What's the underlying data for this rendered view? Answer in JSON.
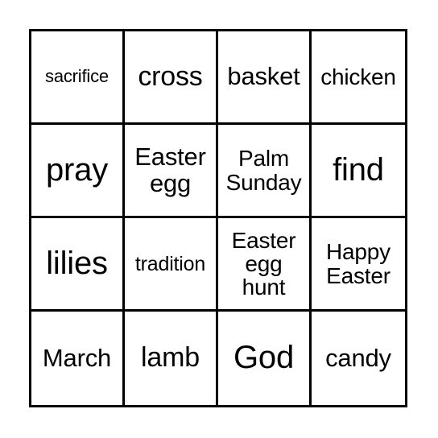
{
  "card": {
    "type": "bingo-card",
    "grid": {
      "rows": 4,
      "columns": 4
    },
    "colors": {
      "border": "#000000",
      "background": "#ffffff",
      "text": "#000000"
    },
    "cells": [
      {
        "text": "sacrifice",
        "size": "fs-xs",
        "lines": 1
      },
      {
        "text": "cross",
        "size": "fs-xl",
        "lines": 1
      },
      {
        "text": "basket",
        "size": "fs-lg",
        "lines": 1
      },
      {
        "text": "chicken",
        "size": "fs-md",
        "lines": 1
      },
      {
        "text": "pray",
        "size": "fs-xxl",
        "lines": 1
      },
      {
        "text": "Easter\negg",
        "size": "fs-lg",
        "lines": 2
      },
      {
        "text": "Palm\nSunday",
        "size": "fs-md",
        "lines": 2
      },
      {
        "text": "find",
        "size": "fs-xxl",
        "lines": 1
      },
      {
        "text": "lilies",
        "size": "fs-xxl",
        "lines": 1
      },
      {
        "text": "tradition",
        "size": "fs-sm",
        "lines": 1
      },
      {
        "text": "Easter\negg\nhunt",
        "size": "fs-md",
        "lines": 3
      },
      {
        "text": "Happy\nEaster",
        "size": "fs-md",
        "lines": 2
      },
      {
        "text": "March",
        "size": "fs-lg",
        "lines": 1
      },
      {
        "text": "lamb",
        "size": "fs-xl",
        "lines": 1
      },
      {
        "text": "God",
        "size": "fs-xxl",
        "lines": 1
      },
      {
        "text": "candy",
        "size": "fs-lg",
        "lines": 1
      }
    ]
  }
}
